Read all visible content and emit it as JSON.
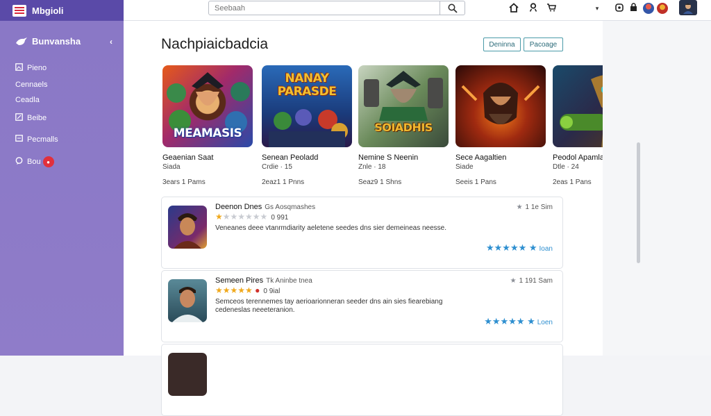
{
  "brand": {
    "name": "Mbgioli"
  },
  "search": {
    "placeholder": "Seebaah"
  },
  "topbar": {
    "icons": [
      "home-icon",
      "user-icon",
      "cart-icon",
      "dropdown-icon",
      "settings-icon",
      "lock-icon",
      "avatar-blue",
      "avatar-red",
      "profile-avatar"
    ]
  },
  "sidebar": {
    "title": "Bunvansha",
    "items": [
      {
        "label": "Pieno",
        "icon": "image-icon"
      },
      {
        "label": "Cennaels",
        "icon": ""
      },
      {
        "label": "Ceadla",
        "icon": ""
      },
      {
        "label": "Beibe",
        "icon": "edit-icon"
      },
      {
        "label": "Pecmalls",
        "icon": "list-icon"
      },
      {
        "label": "Bou",
        "icon": "chat-icon"
      }
    ]
  },
  "main": {
    "title": "Nachpiaicbadcia",
    "btn_primary": "Deninna",
    "btn_secondary": "Pacoage"
  },
  "apps": [
    {
      "thumb_text": "MEAMASIS",
      "name": "Geaenian Saat",
      "category": "Siada",
      "stats": "3ears 1 Pams"
    },
    {
      "thumb_text": "NANAY PARASDE",
      "name": "Senean Peoladd",
      "category": "Crdie · 15",
      "stats": "2eaz1 1 Pnns"
    },
    {
      "thumb_text": "SOIADHIS",
      "name": "Nemine S Neenin",
      "category": "Znle · 18",
      "stats": "Seaz9 1 Shns"
    },
    {
      "thumb_text": "",
      "name": "Sece Aagaltien",
      "category": "Siade",
      "stats": "Seeis 1 Pans"
    },
    {
      "thumb_text": "",
      "name": "Peodol Apamlan",
      "category": "Dtle · 24",
      "stats": "2eas 1 Pans"
    }
  ],
  "reviews": [
    {
      "author": "Deenon Dnes",
      "subtitle": "Gs Aosqmashes",
      "stars": 1,
      "meta": "0 991",
      "text": "Veneanes deee vtanrmdiarity aeletene seedes dns sier demeineas neesse.",
      "date": "1 1e  Sim",
      "rating_label": "Ioan"
    },
    {
      "author": "Semeen Pires",
      "subtitle": "Tk Aninbe tnea",
      "stars": 5,
      "meta": "0 9ial",
      "text": "Semceos terennemes tay aerioarionneran seeder dns ain sies fiearebiang cedeneslas neeeteranion.",
      "date": "1 191  Sam",
      "rating_label": "Loen"
    }
  ],
  "colors": {
    "brand": "#5a4aa8",
    "sidebar": "#8a78c6",
    "accent_blue": "#2e8fd0",
    "star_gold": "#f0a91d"
  }
}
